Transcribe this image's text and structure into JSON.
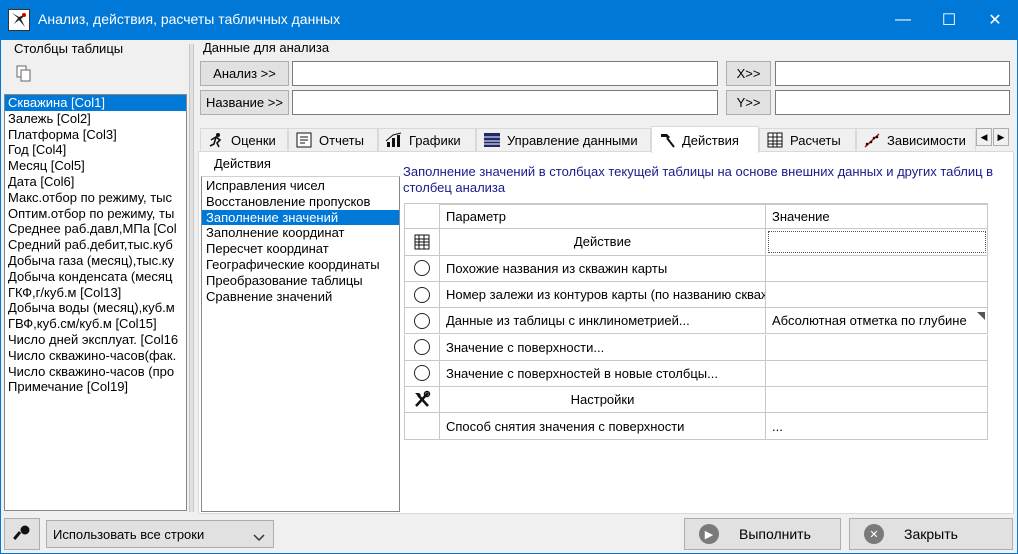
{
  "window": {
    "title": "Анализ, действия, расчеты табличных данных",
    "minimize": "—",
    "maximize": "☐",
    "close": "✕"
  },
  "left_panel": {
    "caption": "Столбцы таблицы",
    "columns": [
      "Скважина [Col1]",
      "Залежь [Col2]",
      "Платформа [Col3]",
      "Год [Col4]",
      "Месяц [Col5]",
      "Дата [Col6]",
      "Макс.отбор по режиму, тыс",
      "Оптим.отбор по режиму, ты",
      "Среднее раб.давл,МПа [Col",
      "Средний раб.дебит,тыс.куб",
      "Добыча газа (месяц),тыс.ку",
      "Добыча конденсата (месяц",
      "ГКФ,г/куб.м [Col13]",
      "Добыча воды (месяц),куб.м",
      "ГВФ,куб.см/куб.м [Col15]",
      "Число дней эксплуат. [Col16",
      "Число скважино-часов(фак.",
      "Число скважино-часов (про",
      "Примечание [Col19]"
    ],
    "selected_index": 0
  },
  "data_section": {
    "caption": "Данные для анализа",
    "analysis_button": "Анализ >>",
    "name_button": "Название >>",
    "x_button": "X>>",
    "y_button": "Y>>",
    "analysis_value": "",
    "name_value": "",
    "x_value": "",
    "y_value": ""
  },
  "tabs": [
    {
      "label": "Оценки",
      "icon": "runner-icon"
    },
    {
      "label": "Отчеты",
      "icon": "report-icon"
    },
    {
      "label": "Графики",
      "icon": "chart-icon"
    },
    {
      "label": "Управление данными",
      "icon": "table-icon"
    },
    {
      "label": "Действия",
      "icon": "hammer-icon"
    },
    {
      "label": "Расчеты",
      "icon": "grid-icon"
    },
    {
      "label": "Зависимости",
      "icon": "scatter-icon"
    }
  ],
  "active_tab": 4,
  "actions": {
    "caption": "Действия",
    "items": [
      "Исправления чисел",
      "Восстановление пропусков",
      "Заполнение значений",
      "Заполнение координат",
      "Пересчет координат",
      "Географические координаты",
      "Преобразование таблицы",
      "Сравнение значений"
    ],
    "selected_index": 2
  },
  "description": "Заполнение значений в столбцах текущей таблицы на основе внешних данных и других таблиц в столбец анализа",
  "grid": {
    "headers": {
      "param": "Параметр",
      "value": "Значение"
    },
    "section_action": "Действие",
    "options": [
      {
        "param": "Похожие названия из скважин карты",
        "value": ""
      },
      {
        "param": "Номер залежи из контуров карты (по названию скважины)",
        "value": ""
      },
      {
        "param": "Данные из таблицы с инклинометрией...",
        "value": "Абсолютная отметка по глубине"
      },
      {
        "param": "Значение с поверхности...",
        "value": ""
      },
      {
        "param": "Значение с поверхностей в новые столбцы...",
        "value": ""
      }
    ],
    "section_settings": "Настройки",
    "settings": [
      {
        "param": "Способ снятия значения с поверхности",
        "value": "..."
      }
    ]
  },
  "bottom": {
    "rows_option": "Использовать все строки",
    "run_button": "Выполнить",
    "close_button": "Закрыть"
  }
}
